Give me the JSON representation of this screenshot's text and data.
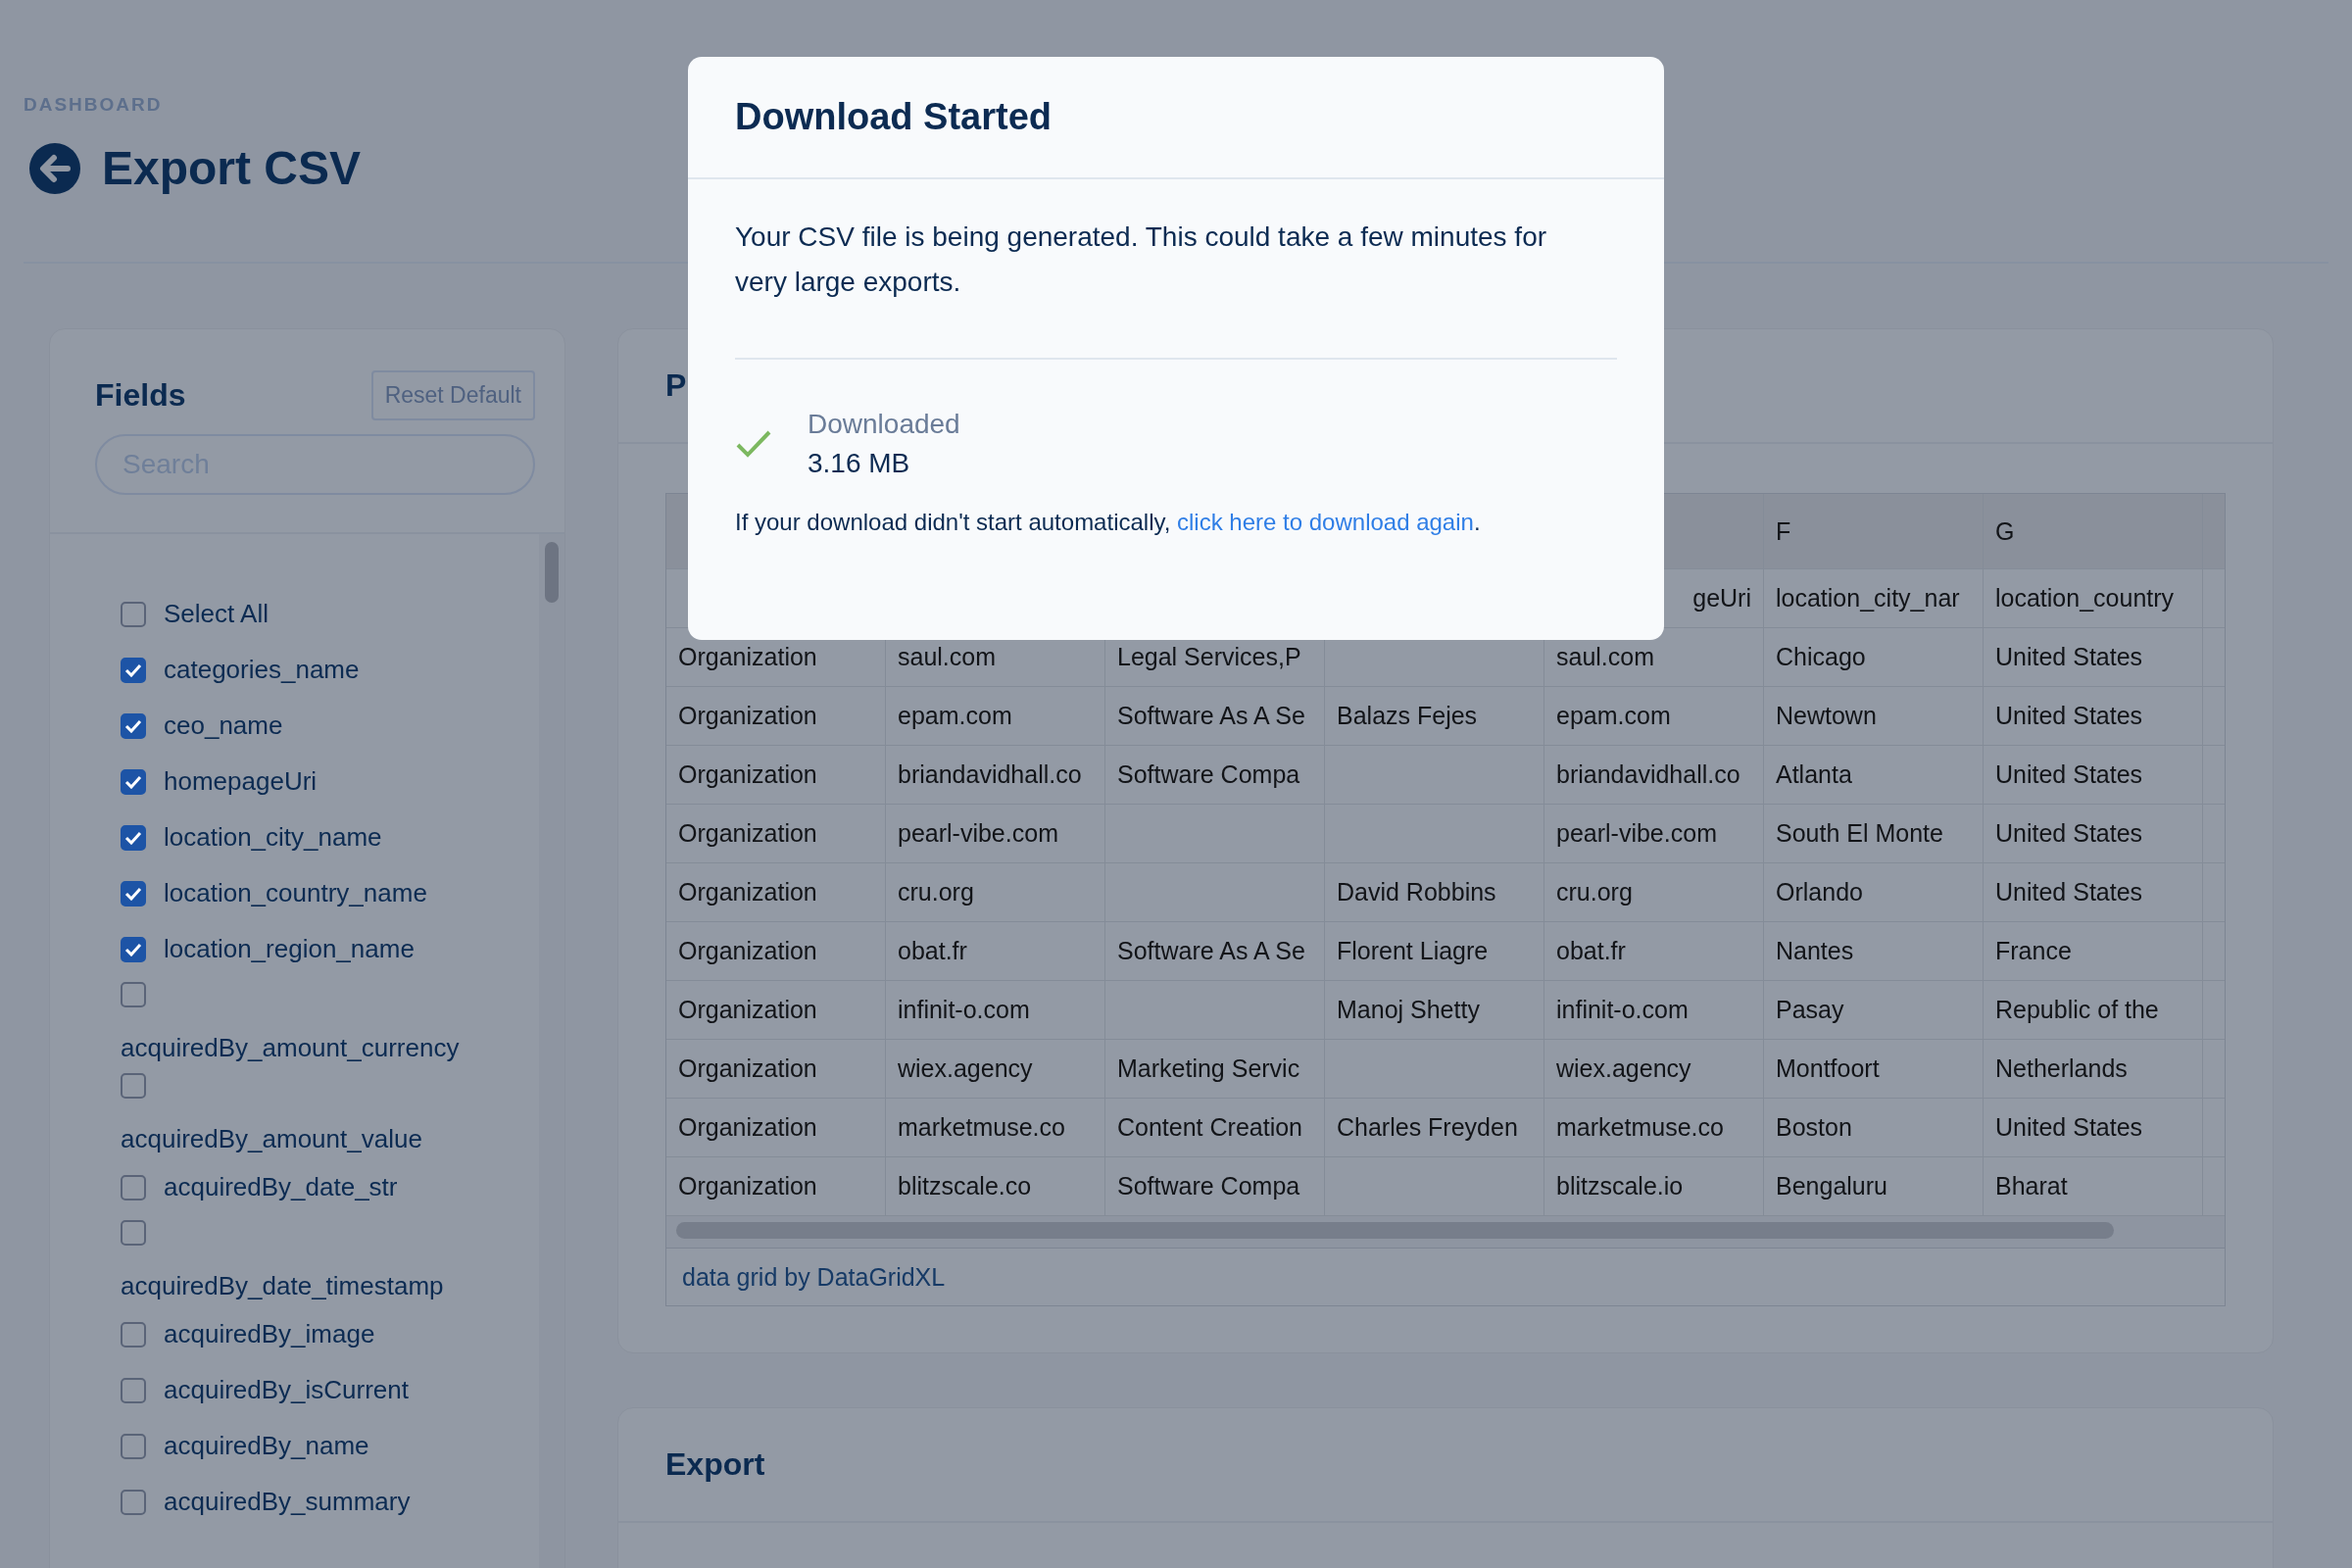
{
  "breadcrumb": "DASHBOARD",
  "page_title": "Export CSV",
  "fields_panel": {
    "title": "Fields",
    "reset_button": "Reset Default",
    "search": {
      "placeholder": "Search"
    },
    "items": [
      {
        "label": "Select All",
        "checked": false
      },
      {
        "label": "categories_name",
        "checked": true
      },
      {
        "label": "ceo_name",
        "checked": true
      },
      {
        "label": "homepageUri",
        "checked": true
      },
      {
        "label": "location_city_name",
        "checked": true
      },
      {
        "label": "location_country_name",
        "checked": true
      },
      {
        "label": "location_region_name",
        "checked": true
      },
      {
        "label": "acquiredBy_amount_currency",
        "checked": false
      },
      {
        "label": "acquiredBy_amount_value",
        "checked": false
      },
      {
        "label": "acquiredBy_date_str",
        "checked": false
      },
      {
        "label": "acquiredBy_date_timestamp",
        "checked": false
      },
      {
        "label": "acquiredBy_image",
        "checked": false
      },
      {
        "label": "acquiredBy_isCurrent",
        "checked": false
      },
      {
        "label": "acquiredBy_name",
        "checked": false
      },
      {
        "label": "acquiredBy_summary",
        "checked": false
      }
    ]
  },
  "preview_panel": {
    "title": "P",
    "grid": {
      "columns": [
        null,
        null,
        null,
        null,
        null,
        "F",
        "G"
      ],
      "rows": [
        {
          "cells": [
            null,
            null,
            null,
            null,
            {
              "text": "geUri",
              "cut_start": true
            },
            "location_city_nar",
            "location_country"
          ]
        },
        {
          "cells": [
            "Organization",
            "saul.com",
            "Legal Services,P",
            null,
            "saul.com",
            "Chicago",
            "United States"
          ]
        },
        {
          "cells": [
            "Organization",
            "epam.com",
            "Software As A Se",
            "Balazs Fejes",
            "epam.com",
            "Newtown",
            "United States"
          ]
        },
        {
          "cells": [
            "Organization",
            "briandavidhall.co",
            "Software Compa",
            null,
            "briandavidhall.co",
            "Atlanta",
            "United States"
          ]
        },
        {
          "cells": [
            "Organization",
            "pearl-vibe.com",
            null,
            null,
            "pearl-vibe.com",
            "South El Monte",
            "United States"
          ]
        },
        {
          "cells": [
            "Organization",
            "cru.org",
            null,
            "David Robbins",
            "cru.org",
            "Orlando",
            "United States"
          ]
        },
        {
          "cells": [
            "Organization",
            "obat.fr",
            "Software As A Se",
            "Florent Liagre",
            "obat.fr",
            "Nantes",
            "France"
          ]
        },
        {
          "cells": [
            "Organization",
            "infinit-o.com",
            null,
            "Manoj Shetty",
            "infinit-o.com",
            "Pasay",
            "Republic of the"
          ]
        },
        {
          "cells": [
            "Organization",
            "wiex.agency",
            "Marketing Servic",
            null,
            "wiex.agency",
            "Montfoort",
            "Netherlands"
          ]
        },
        {
          "cells": [
            "Organization",
            "marketmuse.co",
            "Content Creation",
            "Charles Freyden",
            "marketmuse.co",
            "Boston",
            "United States"
          ]
        },
        {
          "cells": [
            "Organization",
            "blitzscale.co",
            "Software Compa",
            null,
            "blitzscale.io",
            "Bengaluru",
            "Bharat"
          ]
        }
      ],
      "footer": "data grid by DataGridXL"
    }
  },
  "export_panel": {
    "title": "Export"
  },
  "dialog": {
    "title": "Download Started",
    "message": "Your CSV file is being generated. This could take a few minutes for very large exports.",
    "status": {
      "label": "Downloaded",
      "size": "3.16 MB",
      "done": true
    },
    "retry_text": "If your download didn't start automatically, ",
    "retry_link": "click here to download again",
    "retry_end": "."
  }
}
